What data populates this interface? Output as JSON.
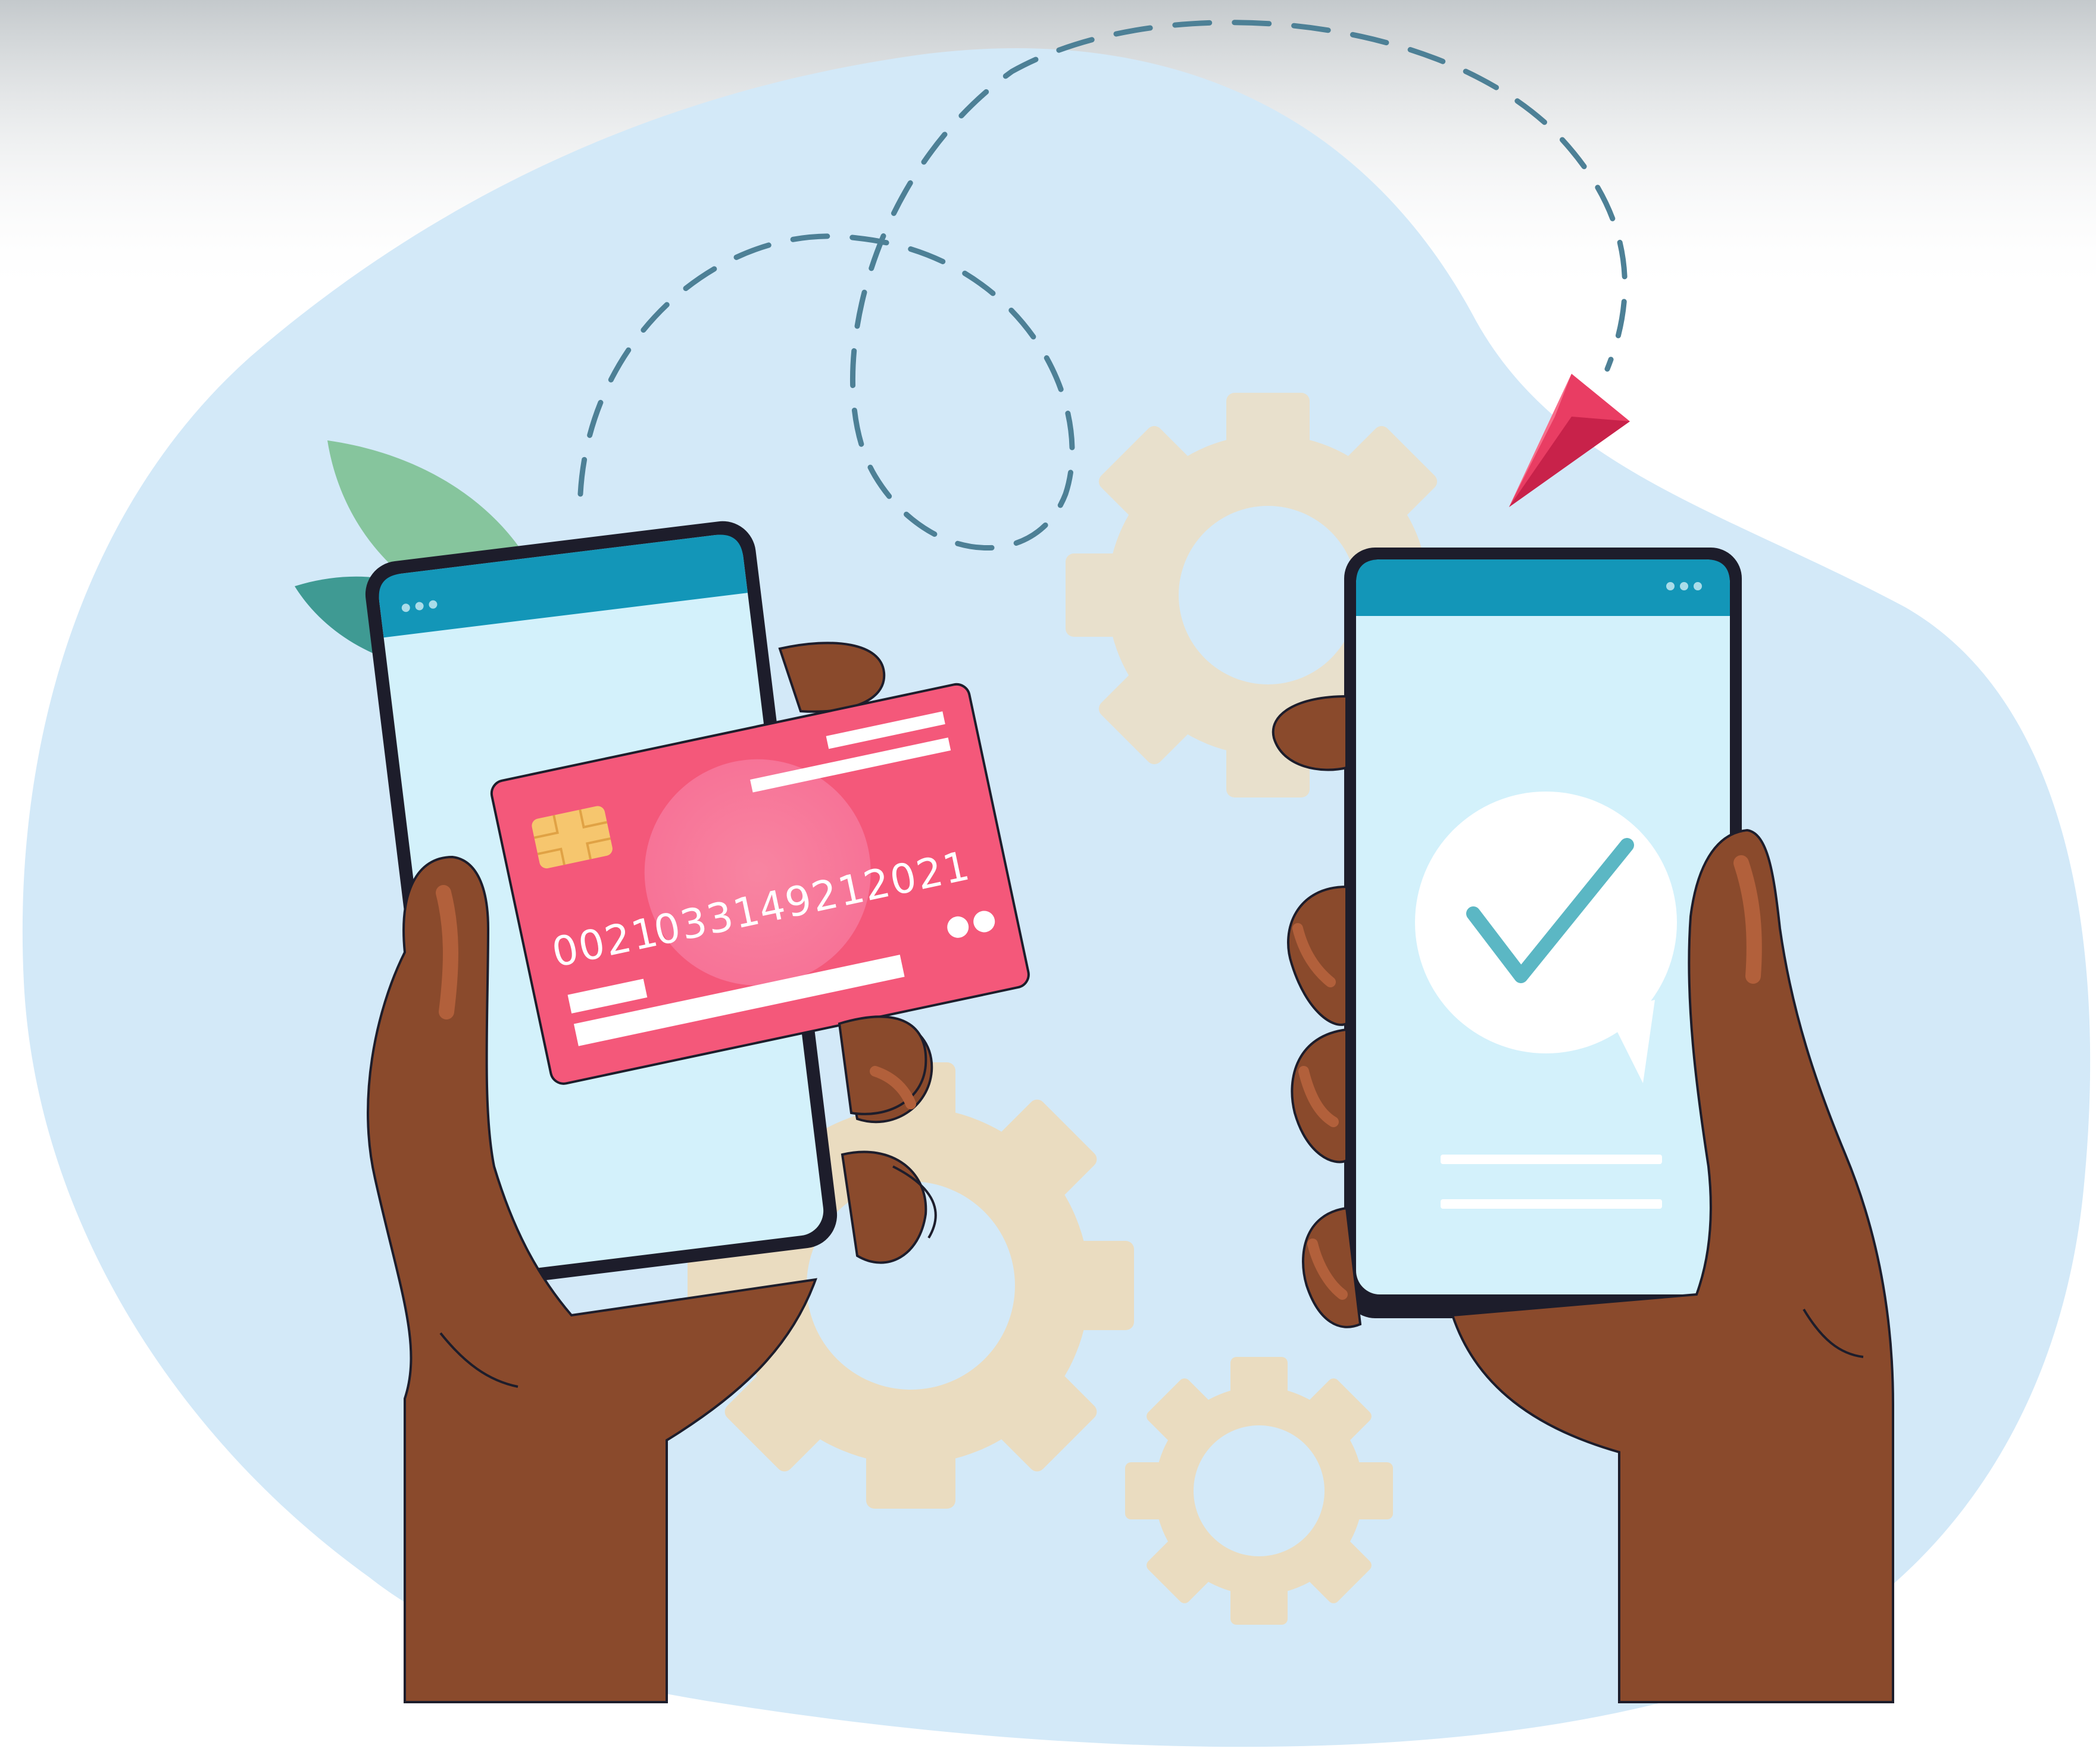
{
  "illustration": {
    "card": {
      "number_groups": [
        "0021",
        "0331",
        "4921",
        "2021"
      ]
    },
    "colors": {
      "background_blob": "#d3e9f8",
      "top_haze": "#c9ced2",
      "gear": "#e8dcc4",
      "phone_frame": "#1d1d2b",
      "phone_screen": "#d3f1fb",
      "phone_header": "#1396b8",
      "card_pink": "#f4587a",
      "card_highlight": "#f7779a",
      "chip": "#f6c66e",
      "skin": "#8a4a2c",
      "skin_highlight": "#b2603b",
      "leaf_light": "#86c59d",
      "leaf_dark": "#3f9a93",
      "checkmark": "#5bb7c4",
      "plane": "#e93d63",
      "dashed_path": "#4d8096"
    },
    "icons": [
      "checkmark-icon",
      "paper-plane-icon",
      "gear-icon",
      "chip-icon",
      "leaf-icon"
    ]
  }
}
